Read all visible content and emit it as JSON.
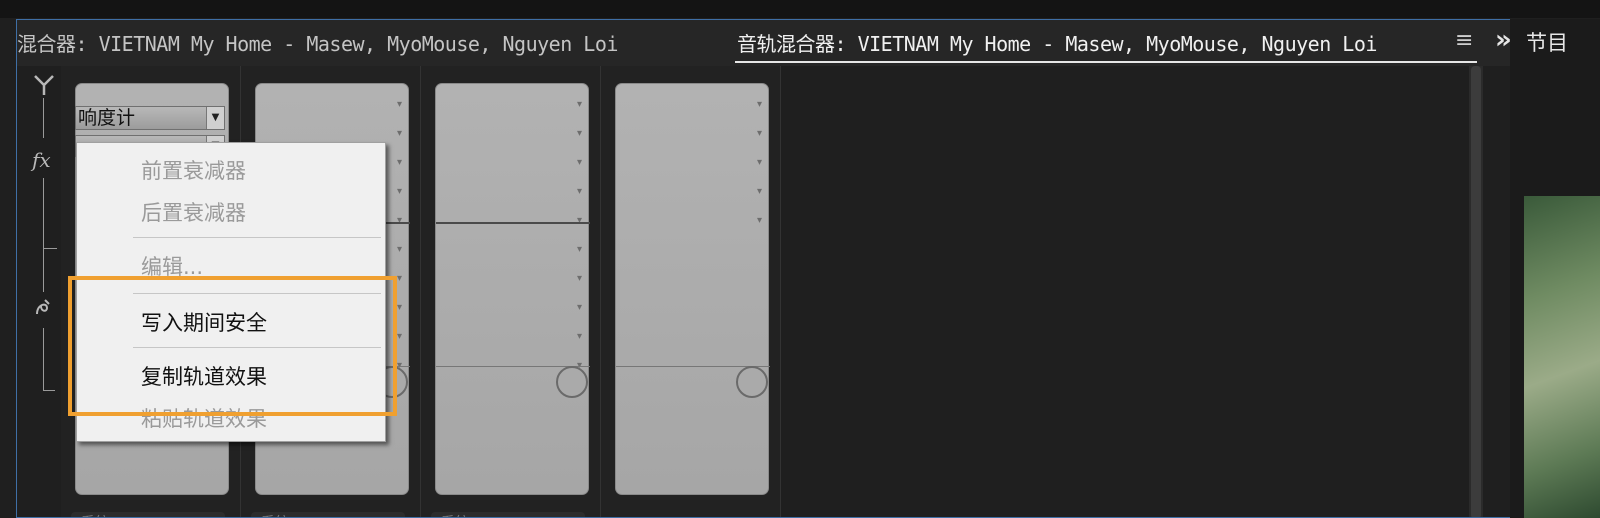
{
  "panel": {
    "inactive_tab_title": "混合器: VIETNAM   My Home - Masew, MyoMouse, Nguyen Loi",
    "active_tab_title": "音轨混合器: VIETNAM   My Home - Masew, MyoMouse, Nguyen Loi",
    "menu_icon": "≡",
    "overflow_icon": "»"
  },
  "right_panel": {
    "title": "节目"
  },
  "side_rail": {
    "icons": [
      "Y",
      "fx",
      "send-icon"
    ]
  },
  "channel1": {
    "dropdown_label": "响度计",
    "second_dropdown_label": "",
    "footer_label": "系统"
  },
  "channel_footers": [
    "系统",
    "系统",
    "系统"
  ],
  "context_menu": {
    "items": [
      {
        "label": "前置衰减器",
        "state": "disabled"
      },
      {
        "label": "后置衰减器",
        "state": "disabled"
      },
      {
        "label": "编辑...",
        "state": "disabled"
      },
      {
        "label": "写入期间安全",
        "state": "enabled"
      },
      {
        "label": "复制轨道效果",
        "state": "enabled"
      },
      {
        "label": "粘贴轨道效果",
        "state": "disabled"
      }
    ]
  },
  "highlight_color": "#f0a030",
  "accent_border_color": "#3f6fa6"
}
